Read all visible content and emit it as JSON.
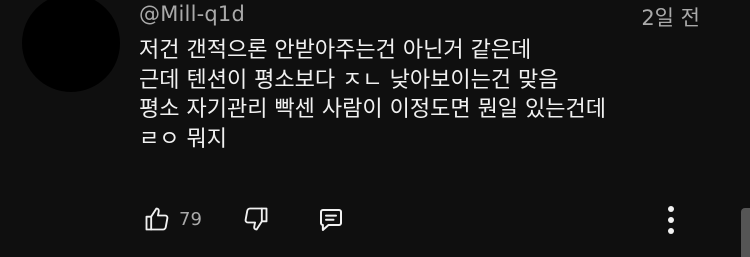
{
  "comment": {
    "author": "@Mill-q1d",
    "timestamp": "2일 전",
    "lines": [
      "저건 갠적으론 안받아주는건 아닌거 같은데",
      "근데 텐션이 평소보다 ㅈㄴ 낮아보이는건 맞음",
      "평소 자기관리 빡센 사람이 이정도면 뭔일 있는건데",
      "ㄹㅇ 뭐지"
    ],
    "like_count": "79"
  },
  "icons": {
    "like": "thumbs-up-icon",
    "dislike": "thumbs-down-icon",
    "reply": "reply-comment-icon",
    "more": "more-vertical-icon"
  },
  "colors": {
    "background": "#0f0f0f",
    "primary_text": "#f1f1f1",
    "secondary_text": "#aaaaaa"
  }
}
